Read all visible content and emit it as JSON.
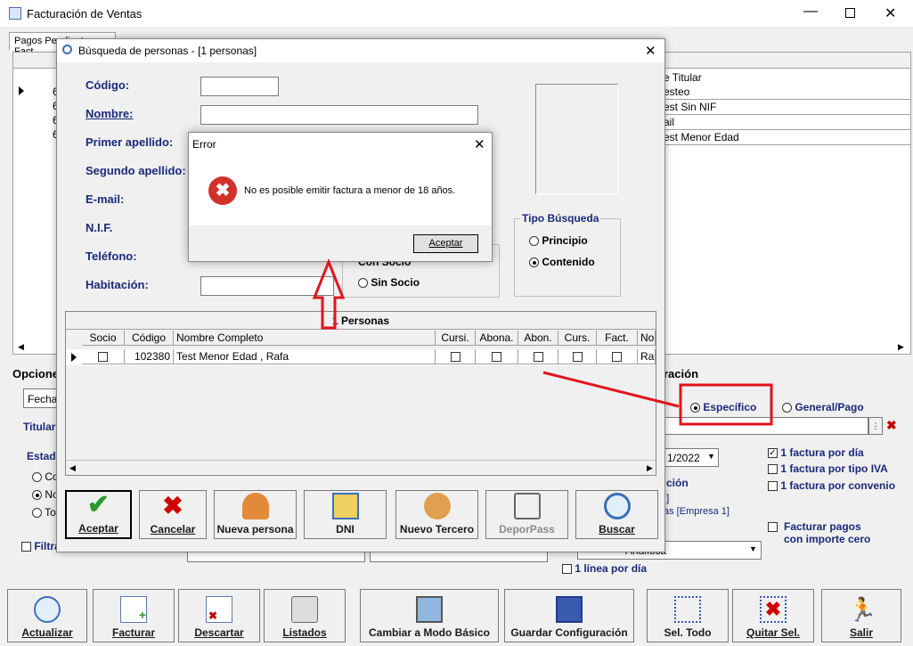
{
  "main_window": {
    "title": "Facturación de Ventas",
    "tab_partial": "Pagos Pendientes Fact",
    "right_table_header": "e Titular",
    "right_table_rows": [
      "esteo",
      "est Sin NIF",
      "ail",
      "est Menor Edad"
    ],
    "left_ids": [
      "6",
      "6",
      "6",
      "6"
    ],
    "opciones_label": "Opcione",
    "fecha_partial": "Fecha",
    "titular_partial": "Titular",
    "estado_partial": "Estad",
    "radio_co": "Co",
    "radio_no": "No",
    "radio_to": "To",
    "filtrar_partial": "Filtra",
    "config_label": "ración",
    "especifico": "Específico",
    "general_pago": "General/Pago",
    "date_value": "1/2022",
    "ion_partial": "ción",
    "empresa_partial": "as [Empresa 1]",
    "bracket_partial": "]",
    "factura_dia": "1 factura por día",
    "factura_iva": "1 factura por tipo IVA",
    "factura_convenio": "1 factura por convenio",
    "facturar_cero_1": "Facturar pagos",
    "facturar_cero_2": "con importe cero",
    "analitica": "Analítica",
    "linea_dia": "1 línea por día"
  },
  "toolbar": {
    "actualizar": "Actualizar",
    "facturar": "Facturar",
    "descartar": "Descartar",
    "listados": "Listados",
    "cambiar": "Cambiar a Modo Básico",
    "guardar": "Guardar Configuración",
    "sel_todo": "Sel. Todo",
    "quitar_sel": "Quitar Sel.",
    "salir": "Salir"
  },
  "search_dialog": {
    "title": "Búsqueda de personas - [1 personas]",
    "codigo": "Código:",
    "nombre": "Nombre:",
    "primer_apellido": "Primer apellido:",
    "segundo_apellido": "Segundo apellido:",
    "email": "E-mail:",
    "nif": "N.I.F.",
    "telefono": "Teléfono:",
    "habitacion": "Habitación:",
    "con_socio_partial": "Con Socio",
    "sin_socio": "Sin Socio",
    "tipo_busqueda": "Tipo Búsqueda",
    "principio": "Principio",
    "contenido": "Contenido",
    "personas_header": "1 Personas",
    "columns": [
      "Socio",
      "Código",
      "Nombre Completo",
      "Cursi.",
      "Abona.",
      "Abon.",
      "Curs.",
      "Fact.",
      "Nor"
    ],
    "row": {
      "codigo": "102380",
      "nombre": "Test Menor Edad , Rafa",
      "last": "Raf"
    },
    "buttons": {
      "aceptar": "Aceptar",
      "cancelar": "Cancelar",
      "nueva_persona": "Nueva persona",
      "dni": "DNI",
      "nuevo_tercero": "Nuevo Tercero",
      "deporpass": "DeporPass",
      "buscar": "Buscar"
    }
  },
  "error_dialog": {
    "title": "Error",
    "message": "No es posible emitir factura a menor de 18 años.",
    "button": "Aceptar"
  }
}
